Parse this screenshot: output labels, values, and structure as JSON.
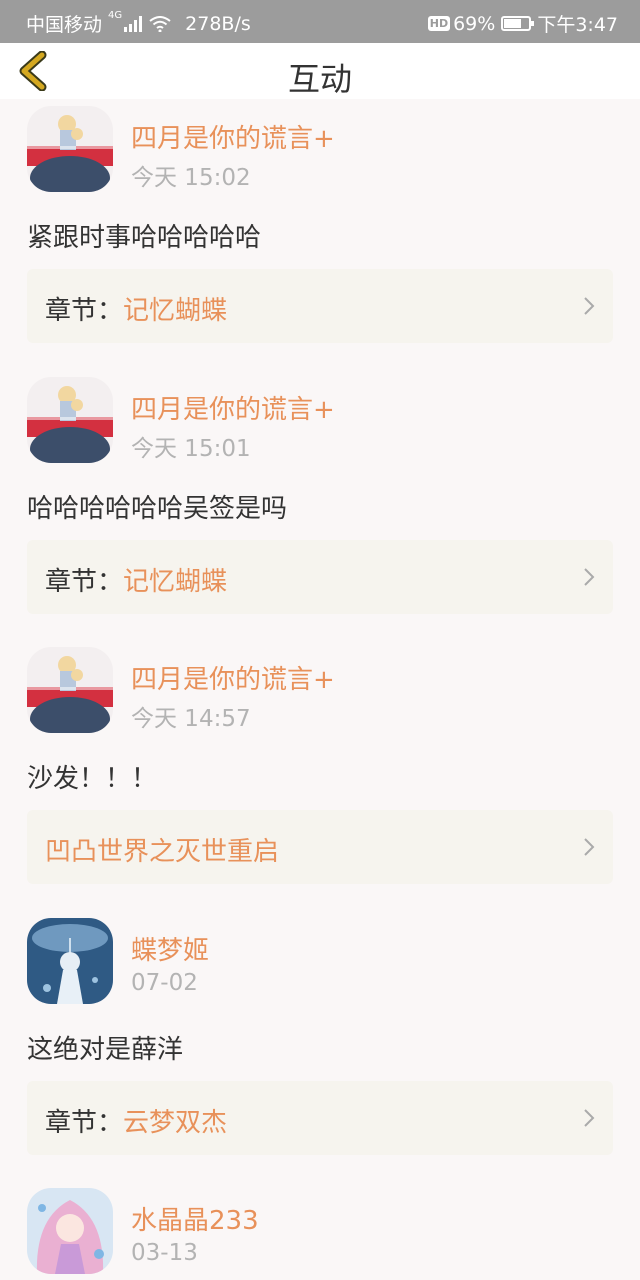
{
  "status_bar": {
    "carrier": "中国移动",
    "network": "4G",
    "speed": "278B/s",
    "hd": "HD",
    "battery_percent": "69%",
    "battery_level": 0.69,
    "time": "下午3:47"
  },
  "header": {
    "title": "互动",
    "back_icon": "chevron-left-icon"
  },
  "colors": {
    "accent": "#e8915a",
    "back_icon": "#d4a820",
    "card_bg": "#f6f4ee",
    "page_bg": "#faf7f7"
  },
  "comments": [
    {
      "user": "四月是你的谎言+",
      "time": "今天 15:02",
      "text": "紧跟时事哈哈哈哈哈",
      "chapter_prefix": "章节：",
      "chapter_name": "记忆蝴蝶"
    },
    {
      "user": "四月是你的谎言+",
      "time": "今天 15:01",
      "text": "哈哈哈哈哈哈吴签是吗",
      "chapter_prefix": "章节：",
      "chapter_name": "记忆蝴蝶"
    },
    {
      "user": "四月是你的谎言+",
      "time": "今天 14:57",
      "text": "沙发！！！",
      "chapter_prefix": "",
      "chapter_name": "凹凸世界之灭世重启"
    },
    {
      "user": "蝶梦姬",
      "time": "07-02",
      "text": "这绝对是薛洋",
      "chapter_prefix": "章节：",
      "chapter_name": "云梦双杰"
    },
    {
      "user": "水晶晶233",
      "time": "03-13"
    }
  ]
}
